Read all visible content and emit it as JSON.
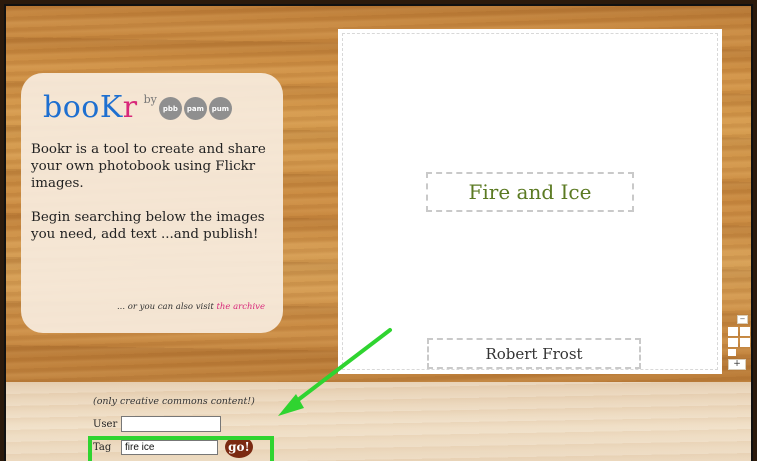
{
  "app": {
    "logo_text_main": "booK",
    "logo_text_accent": "r",
    "logo_by": "by",
    "logo_badges": [
      "pbb",
      "pam",
      "pum"
    ]
  },
  "intro": {
    "paragraph_1": "Bookr is a tool to create and share your own photobook using Flickr images.",
    "paragraph_2": "Begin searching below the images you need, add text ...and publish!",
    "archive_prefix": "... or you can also visit",
    "archive_link": "the archive"
  },
  "book_page": {
    "title": "Fire and Ice",
    "author": "Robert Frost"
  },
  "page_tools": {
    "minus_label": "−",
    "plus_label": "+"
  },
  "search": {
    "note": "(only creative commons content!)",
    "user_label": "User",
    "user_value": "",
    "tag_label": "Tag",
    "tag_value": "fire ice",
    "go_label": "go!"
  },
  "colors": {
    "logo_blue": "#1e6fd0",
    "logo_pink": "#d8287a",
    "title_green": "#5b7a22",
    "highlight_green": "#2fd430",
    "go_button": "#7b2a12"
  }
}
